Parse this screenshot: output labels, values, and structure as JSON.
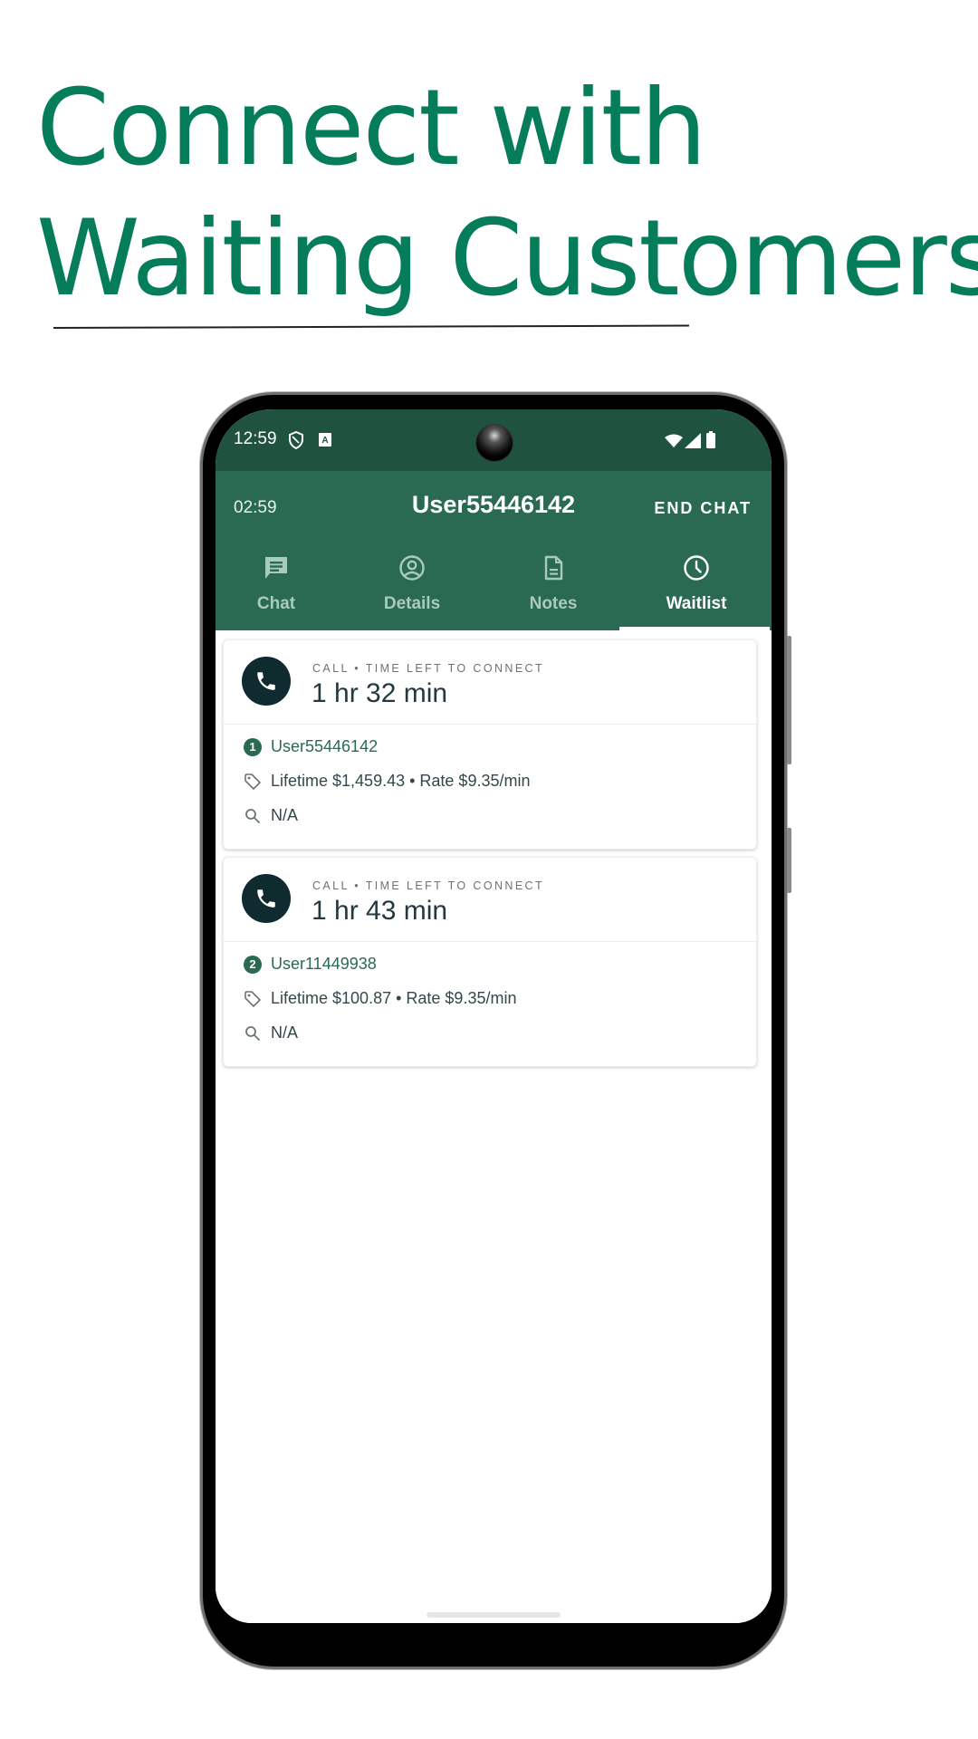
{
  "headline": {
    "line1": "Connect with",
    "line2": "Waiting Customers"
  },
  "colors": {
    "brand_green": "#057c5a",
    "appbar_green": "#2a6a52",
    "statusbar_green": "#1f5340",
    "call_icon_bg": "#0f2b30"
  },
  "status_bar": {
    "time": "12:59",
    "left_icons": [
      "shield-icon",
      "a-box-icon"
    ],
    "right_icons": [
      "wifi-icon",
      "signal-icon",
      "battery-icon"
    ]
  },
  "app_bar": {
    "timer": "02:59",
    "title": "User55446142",
    "end_chat_label": "END CHAT"
  },
  "tabs": [
    {
      "label": "Chat",
      "icon": "chat-icon",
      "active": false
    },
    {
      "label": "Details",
      "icon": "account-circle-icon",
      "active": false
    },
    {
      "label": "Notes",
      "icon": "note-icon",
      "active": false
    },
    {
      "label": "Waitlist",
      "icon": "clock-icon",
      "active": true
    }
  ],
  "waitlist": [
    {
      "type_caption": "CALL • TIME LEFT TO CONNECT",
      "time_left": "1 hr 32 min",
      "position": "1",
      "username": "User55446142",
      "pricing": "Lifetime $1,459.43 • Rate $9.35/min",
      "search_info": "N/A"
    },
    {
      "type_caption": "CALL • TIME LEFT TO CONNECT",
      "time_left": "1 hr 43 min",
      "position": "2",
      "username": "User11449938",
      "pricing": "Lifetime $100.87 • Rate $9.35/min",
      "search_info": "N/A"
    }
  ]
}
